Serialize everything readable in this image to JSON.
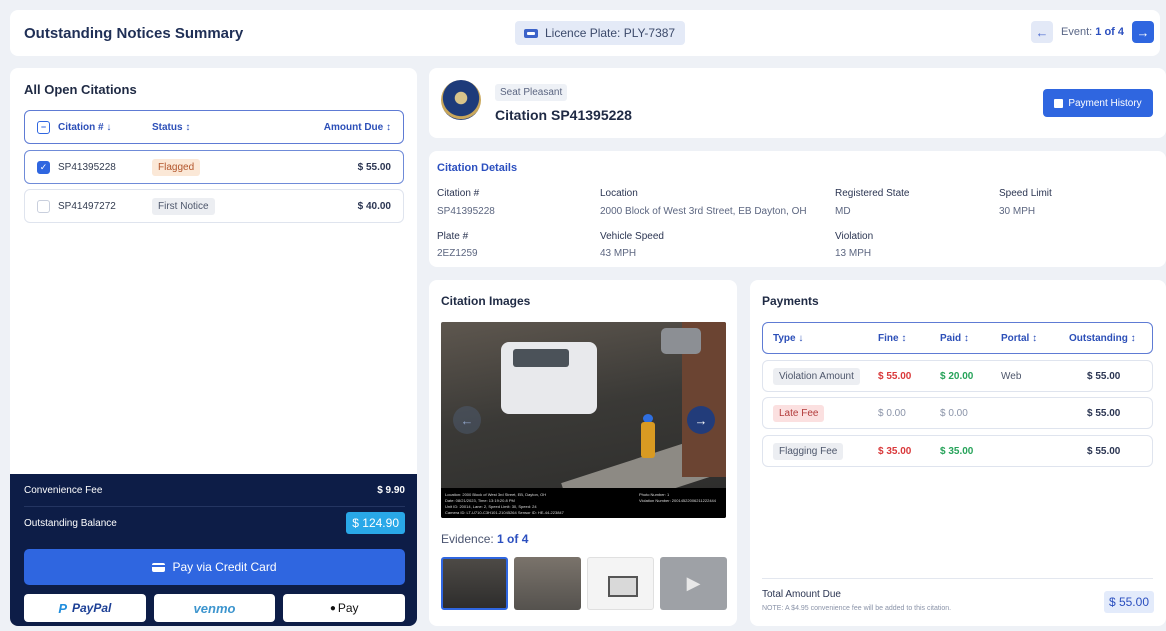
{
  "header": {
    "title": "Outstanding Notices Summary",
    "plate_label": "Licence Plate: PLY-7387",
    "event_prefix": "Event:",
    "event_value": "1 of 4"
  },
  "citations": {
    "heading": "All Open Citations",
    "columns": {
      "number": "Citation #",
      "status": "Status",
      "amount": "Amount Due"
    },
    "rows": [
      {
        "number": "SP41395228",
        "status": "Flagged",
        "amount": "$ 55.00",
        "selected": true
      },
      {
        "number": "SP41497272",
        "status": "First Notice",
        "amount": "$ 40.00",
        "selected": false
      }
    ]
  },
  "payment_footer": {
    "convenience_label": "Convenience Fee",
    "convenience_value": "$ 9.90",
    "balance_label": "Outstanding Balance",
    "balance_value": "$ 124.90",
    "credit_card_label": "Pay via Credit Card",
    "paypal_label": "PayPal",
    "venmo_label": "venmo",
    "applepay_label": "Pay"
  },
  "citation_header": {
    "jurisdiction": "Seat Pleasant",
    "title": "Citation SP41395228",
    "history_button": "Payment History"
  },
  "details": {
    "heading": "Citation Details",
    "fields": [
      {
        "label": "Citation #",
        "value": "SP41395228"
      },
      {
        "label": "Location",
        "value": "2000 Block of West 3rd Street, EB Dayton, OH"
      },
      {
        "label": "Registered State",
        "value": "MD"
      },
      {
        "label": "Speed Limit",
        "value": "30 MPH"
      },
      {
        "label": "Plate #",
        "value": "2EZ1259"
      },
      {
        "label": "Vehicle Speed",
        "value": "43 MPH"
      },
      {
        "label": "Violation",
        "value": "13 MPH"
      }
    ]
  },
  "images": {
    "heading": "Citation Images",
    "caption_left": "Location: 2000 Block of West 3rd Street, EB, Dayton, OH\nDate: 08/21/2023, Time: 13:19:20.8 PM\nUnit ID: 20014, Lane: 2, Speed Limit: 30, Speed: 24\nCamera ID: LT-U710-C3H101-21045264 Sensor ID: HE-44-223847",
    "caption_right": "Photo Number: 1\nViolation Number: 20014522006211222444",
    "evidence_prefix": "Evidence:",
    "evidence_value": "1 of 4"
  },
  "payments": {
    "heading": "Payments",
    "columns": {
      "type": "Type",
      "fine": "Fine",
      "paid": "Paid",
      "portal": "Portal",
      "outstanding": "Outstanding"
    },
    "rows": [
      {
        "type": "Violation Amount",
        "fine": "$ 55.00",
        "paid": "$ 20.00",
        "portal": "Web",
        "outstanding": "$ 55.00"
      },
      {
        "type": "Late Fee",
        "fine": "$ 0.00",
        "paid": "$ 0.00",
        "portal": "",
        "outstanding": "$ 55.00"
      },
      {
        "type": "Flagging Fee",
        "fine": "$ 35.00",
        "paid": "$ 35.00",
        "portal": "",
        "outstanding": "$ 55.00"
      }
    ],
    "total_label": "Total Amount Due",
    "total_note": "NOTE: A $4.95 convenience fee will be added to this citation.",
    "total_value": "$ 55.00"
  },
  "colors": {
    "primary": "#2f66e0",
    "navy_footer": "#0d1d47",
    "balance": "#29a8e8",
    "fine_red": "#d9383a",
    "paid_green": "#27a35a"
  }
}
